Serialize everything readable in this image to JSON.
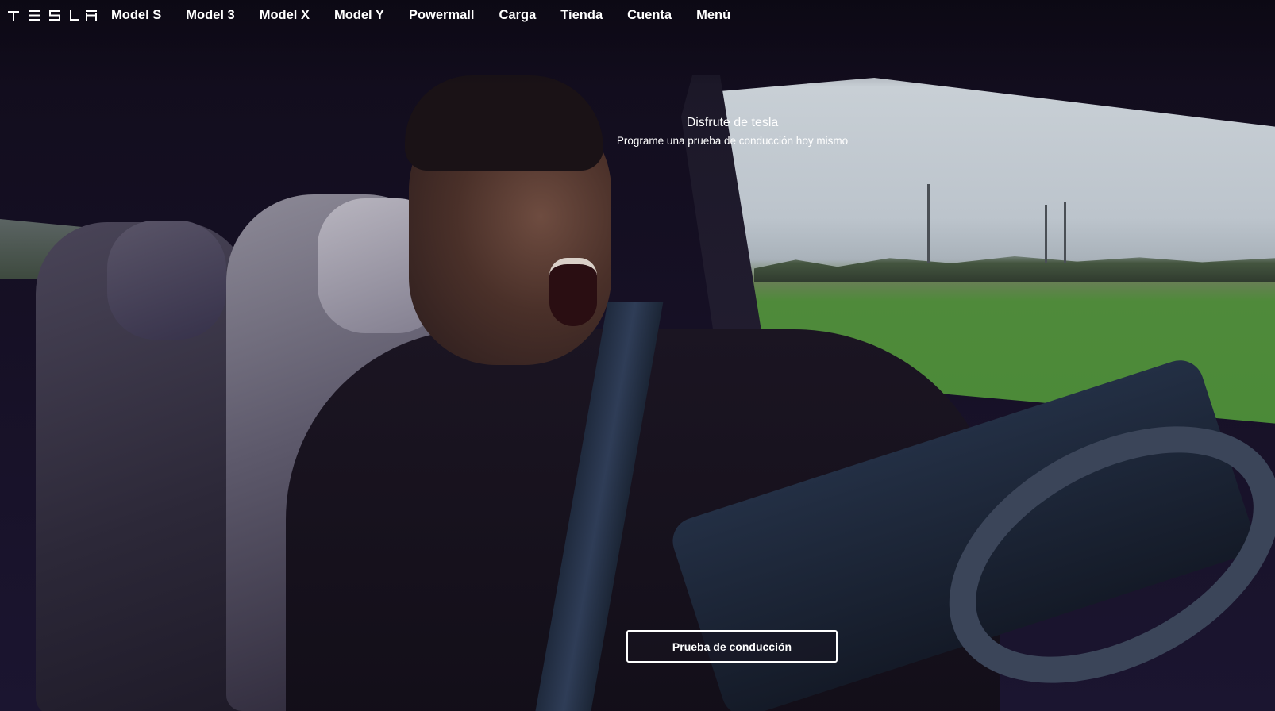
{
  "nav": {
    "brand": "TESLA",
    "links": [
      {
        "label": "Model S"
      },
      {
        "label": "Model 3"
      },
      {
        "label": "Model X"
      },
      {
        "label": "Model Y"
      },
      {
        "label": "Powermall"
      },
      {
        "label": "Carga"
      },
      {
        "label": "Tienda"
      },
      {
        "label": "Cuenta"
      },
      {
        "label": "Menú"
      }
    ]
  },
  "hero": {
    "title": "Disfrute de tesla",
    "subtitle": "Programe una prueba de conducción hoy mismo"
  },
  "cta": {
    "label": "Prueba de conducción"
  },
  "background": {
    "icon": "car-interior-driver-photo"
  }
}
